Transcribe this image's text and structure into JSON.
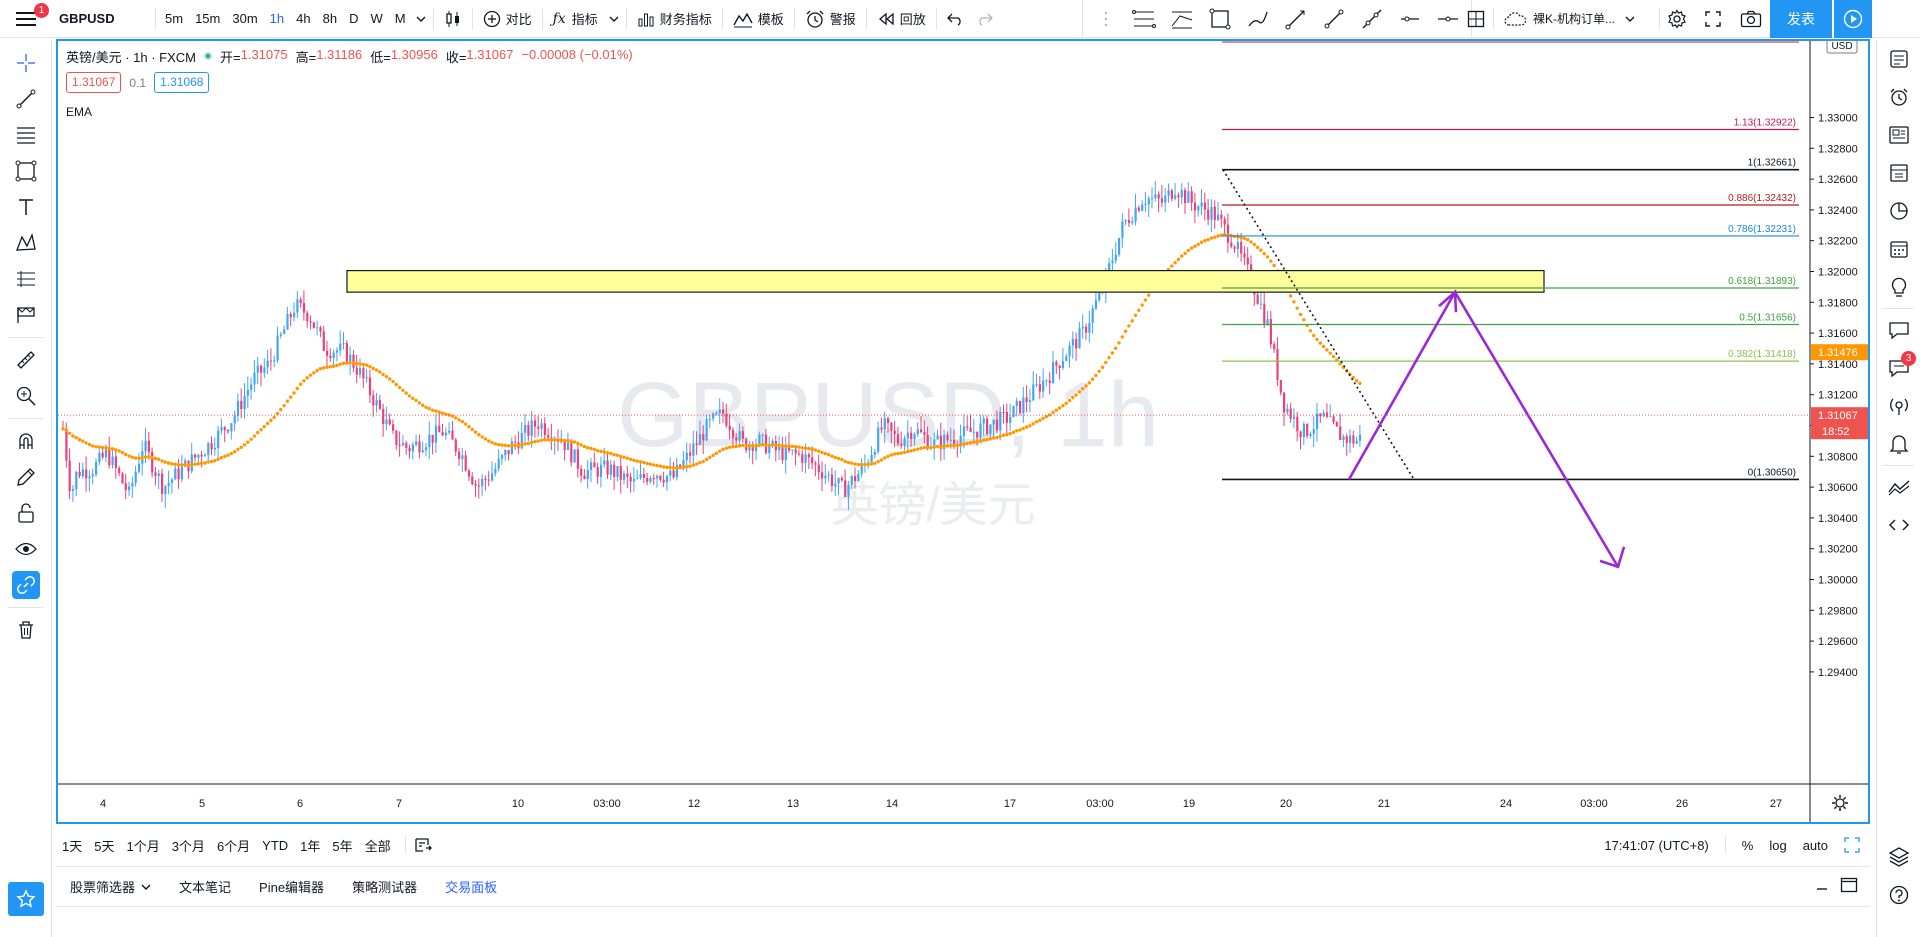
{
  "app": {
    "badge_menu": "1",
    "badge_notifications": "3"
  },
  "topbar": {
    "symbol": "GBPUSD",
    "intervals": [
      "5m",
      "15m",
      "30m",
      "1h",
      "4h",
      "8h",
      "D",
      "W",
      "M"
    ],
    "active_interval": "1h",
    "compare_label": "对比",
    "indicators_label": "指标",
    "financials_label": "财务指标",
    "templates_label": "模板",
    "alert_label": "警报",
    "replay_label": "回放",
    "layout_name": "裸K-机构订单...",
    "publish_label": "发表"
  },
  "legend": {
    "title": "英镑/美元 · 1h · FXCM",
    "open_k": "开=",
    "open_v": "1.31075",
    "high_k": "高=",
    "high_v": "1.31186",
    "low_k": "低=",
    "low_v": "1.30956",
    "close_k": "收=",
    "close_v": "1.31067",
    "change_v": "−0.00008 (−0.01%)",
    "bid": "1.31067",
    "spread": "0.1",
    "ask": "1.31068",
    "indicator": "EMA"
  },
  "watermark": {
    "main": "GBPUSD, 1h",
    "sub": "英镑/美元"
  },
  "price_axis": {
    "currency": "USD",
    "ticks": [
      "1.33000",
      "1.32800",
      "1.32600",
      "1.32400",
      "1.32200",
      "1.32000",
      "1.31800",
      "1.31600",
      "1.31400",
      "1.31200",
      "1.31000",
      "1.30800",
      "1.30600",
      "1.30400",
      "1.30200",
      "1.30000",
      "1.29800",
      "1.29600",
      "1.29400"
    ],
    "ema_label": "1.31476",
    "last_label": "1.31067",
    "countdown": "18:52"
  },
  "time_axis": {
    "ticks": [
      "4",
      "5",
      "6",
      "7",
      "10",
      "03:00",
      "12",
      "13",
      "14",
      "17",
      "03:00",
      "19",
      "20",
      "21",
      "24",
      "03:00",
      "26",
      "27"
    ]
  },
  "fib": {
    "levels": [
      {
        "label": "1.13(1.32922)",
        "color": "#c2185b",
        "price": 1.32922
      },
      {
        "label": "1(1.32661)",
        "color": "#131722",
        "price": 1.32661
      },
      {
        "label": "0.886(1.32432)",
        "color": "#b71c1c",
        "price": 1.32432
      },
      {
        "label": "0.786(1.32231)",
        "color": "#1e88e5",
        "price": 1.32231
      },
      {
        "label": "0.618(1.31893)",
        "color": "#43a047",
        "price": 1.31893
      },
      {
        "label": "0.5(1.31656)",
        "color": "#43a047",
        "price": 1.31656
      },
      {
        "label": "0.382(1.31418)",
        "color": "#8bc34a",
        "price": 1.31418
      },
      {
        "label": "0(1.30650)",
        "color": "#131722",
        "price": 1.3065
      }
    ]
  },
  "range_bar": {
    "ranges": [
      "1天",
      "5天",
      "1个月",
      "3个月",
      "6个月",
      "YTD",
      "1年",
      "5年",
      "全部"
    ],
    "clock": "17:41:07 (UTC+8)",
    "percent": "%",
    "log": "log",
    "auto": "auto"
  },
  "bottom_panel": {
    "tabs": [
      "股票筛选器",
      "文本笔记",
      "Pine编辑器",
      "策略测试器",
      "交易面板"
    ],
    "active_tab": "交易面板"
  },
  "colors": {
    "accent": "#2196f3",
    "bull": "#42a5f5",
    "bear": "#ec407a",
    "ema": "#ff9800",
    "zone": "#ffff99",
    "arrow": "#9c27d9"
  }
}
